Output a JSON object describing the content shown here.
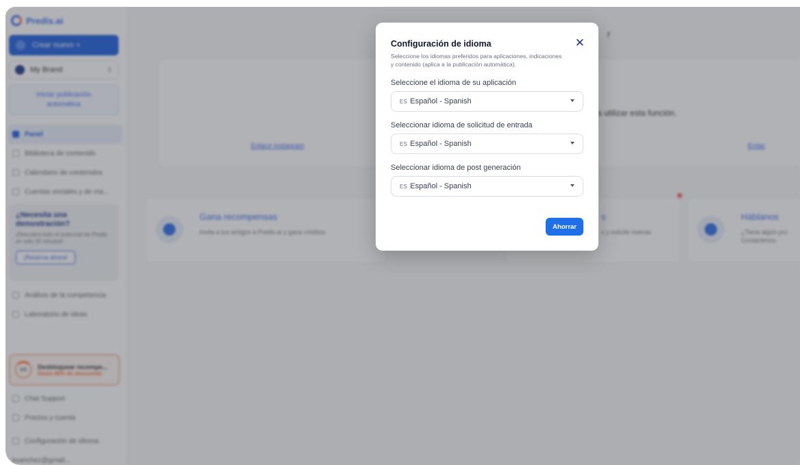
{
  "sidebar": {
    "logo": "Predis.ai",
    "create_label": "Crear nuevo +",
    "brand": "My Brand",
    "auto_publish": "Iniciar publicación automática",
    "nav": [
      {
        "label": "Panel",
        "icon": "grid-icon",
        "active": true
      },
      {
        "label": "Biblioteca de contenido",
        "icon": "library-icon"
      },
      {
        "label": "Calendario de contenidos",
        "icon": "calendar-icon"
      },
      {
        "label": "Cuentas sociales y de ma...",
        "icon": "accounts-icon"
      }
    ],
    "demo": {
      "title": "¿Necesita una demostración?",
      "subtitle": "¡Descubra todo el potencial de Predis en solo 30 minutos!",
      "button": "¡Reserva ahora!"
    },
    "nav2": [
      {
        "label": "Análisis de la competencia",
        "icon": "analysis-icon"
      },
      {
        "label": "Laboratorio de ideas",
        "icon": "lab-icon"
      }
    ],
    "reward": {
      "ring": "5/6",
      "title": "Desbloquear recompe...",
      "subtitle": "Hasta 46% de descuento"
    },
    "nav3": [
      {
        "label": "Chat Support",
        "icon": "chat-icon"
      },
      {
        "label": "Precios y cuenta",
        "icon": "pricing-icon"
      },
      {
        "label": "Configuración de idioma",
        "icon": "language-icon"
      }
    ],
    "footer_user": "ksanchez@gmail..."
  },
  "main": {
    "greeting": "r",
    "top_message": "a utilizar esta función.",
    "link_instagram": "Enlace Instagram",
    "link_other": "Enlac",
    "promos": [
      {
        "title": "Gana recompensas",
        "subtitle": "Invita a tus amigos a Predis.ai y gana créditos"
      },
      {
        "title": "s",
        "subtitle": "s y solicite nuevas"
      },
      {
        "title": "Háblanos",
        "subtitle": "¿Tiene algún pro Contáctenos."
      }
    ]
  },
  "modal": {
    "title": "Configuración de idioma",
    "subtitle": "Seleccione los idiomas preferidos para aplicaciones, indicaciones y contenido (aplica a la publicación automática).",
    "fields": [
      {
        "label": "Seleccione el idioma de su aplicación",
        "code": "ES",
        "value": "Español - Spanish"
      },
      {
        "label": "Seleccionar idioma de solicitud de entrada",
        "code": "ES",
        "value": "Español - Spanish"
      },
      {
        "label": "Seleccionar idioma de post generación",
        "code": "ES",
        "value": "Español - Spanish"
      }
    ],
    "close_symbol": "✕",
    "save_label": "Ahorrar"
  },
  "colors": {
    "primary": "#1f6fe8",
    "accent": "#3b6cf6",
    "overlay": "#3c3e46"
  }
}
